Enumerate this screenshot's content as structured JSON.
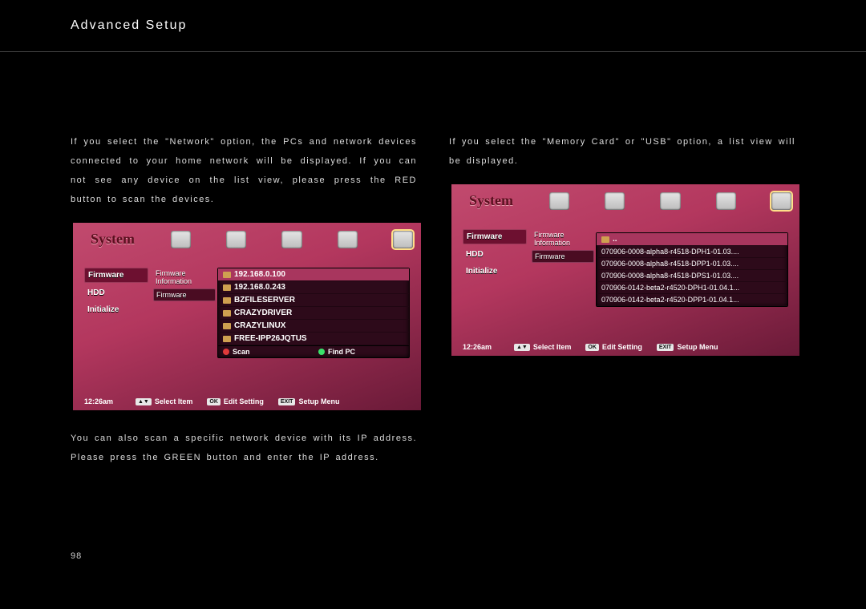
{
  "page_title": "Advanced Setup",
  "page_number": "98",
  "left": {
    "para1": "If you select the \"Network\" option, the PCs and network devices connected to your home network will be displayed. If you can not see any device on the list view, please press the RED button to scan the devices.",
    "para2": "You can also scan a specific network device with its IP address. Please press the GREEN button and enter the IP address."
  },
  "right": {
    "para1": "If you select the \"Memory Card\" or \"USB\" option, a list view will be displayed."
  },
  "ui": {
    "logo": "System",
    "side": {
      "firmware": "Firmware",
      "hdd": "HDD",
      "initialize": "Initialize"
    },
    "sub": {
      "info": "Firmware Information",
      "update": "Firmware"
    },
    "clock": "12:26am",
    "hint_select": "Select Item",
    "hint_edit": "Edit Setting",
    "hint_menu": "Setup Menu",
    "btn_updown": "▲▼",
    "btn_ok": "OK",
    "btn_exit": "EXIT",
    "scan": "Scan",
    "findpc": "Find PC",
    "dotdot": ".."
  },
  "shot1_rows": [
    "192.168.0.100",
    "192.168.0.243",
    "BZFILESERVER",
    "CRAZYDRIVER",
    "CRAZYLINUX",
    "FREE-IPP26JQTUS"
  ],
  "shot2_rows": [
    "070906-0008-alpha8-r4518-DPH1-01.03....",
    "070906-0008-alpha8-r4518-DPP1-01.03....",
    "070906-0008-alpha8-r4518-DPS1-01.03....",
    "070906-0142-beta2-r4520-DPH1-01.04.1...",
    "070906-0142-beta2-r4520-DPP1-01.04.1..."
  ]
}
